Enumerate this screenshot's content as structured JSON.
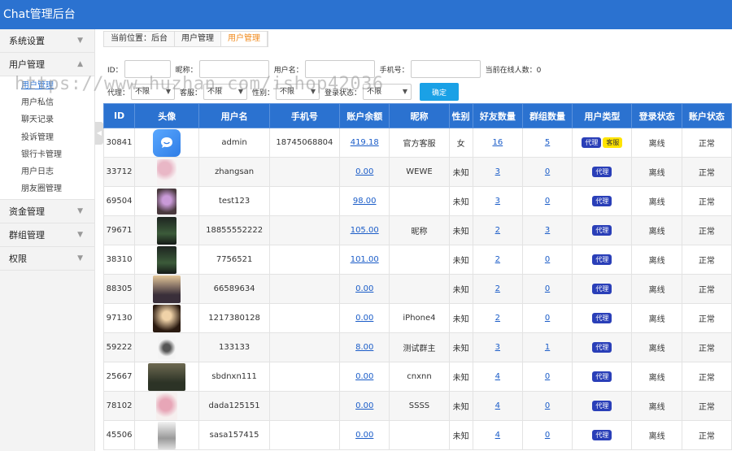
{
  "app": {
    "title": "Chat管理后台"
  },
  "sidebar": {
    "menus": [
      {
        "label": "系统设置",
        "expanded": false
      },
      {
        "label": "用户管理",
        "expanded": true,
        "items": [
          "用户管理",
          "用户私信",
          "聊天记录",
          "投诉管理",
          "银行卡管理",
          "用户日志",
          "朋友圈管理"
        ],
        "active_index": 0
      },
      {
        "label": "资金管理",
        "expanded": false
      },
      {
        "label": "群组管理",
        "expanded": false
      },
      {
        "label": "权限",
        "expanded": false
      }
    ]
  },
  "breadcrumb": [
    "当前位置：后台",
    "用户管理",
    "用户管理"
  ],
  "filters": {
    "id_label": "ID：",
    "nickname_label": "昵称：",
    "username_label": "用户名：",
    "phone_label": "手机号：",
    "online_text": "当前在线人数：0",
    "agent_label": "代理：",
    "agent_value": "不限",
    "cs_label": "客服：",
    "cs_value": "不限",
    "gender_label": "性别：",
    "gender_value": "不限",
    "login_label": "登录状态：",
    "login_value": "不限",
    "confirm": "确定"
  },
  "watermark": "https://www.huzhan.com/ishop42036",
  "table": {
    "headers": [
      "ID",
      "头像",
      "用户名",
      "手机号",
      "账户余额",
      "昵称",
      "性别",
      "好友数量",
      "群组数量",
      "用户类型",
      "登录状态",
      "账户状态"
    ],
    "rows": [
      {
        "id": "30841",
        "avatar": "chat-logo",
        "username": "admin",
        "phone": "18745068804",
        "balance": "419.18",
        "nickname": "官方客服",
        "gender": "女",
        "friends": "16",
        "groups": "5",
        "types": [
          "代理",
          "客服"
        ],
        "login": "离线",
        "status": "正常"
      },
      {
        "id": "33712",
        "avatar": "flowers",
        "username": "zhangsan",
        "phone": "",
        "balance": "0.00",
        "nickname": "WEWE",
        "gender": "未知",
        "friends": "3",
        "groups": "0",
        "types": [
          "代理"
        ],
        "login": "离线",
        "status": "正常"
      },
      {
        "id": "69504",
        "avatar": "purple-flower",
        "username": "test123",
        "phone": "",
        "balance": "98.00",
        "nickname": "",
        "gender": "未知",
        "friends": "3",
        "groups": "0",
        "types": [
          "代理"
        ],
        "login": "离线",
        "status": "正常"
      },
      {
        "id": "79671",
        "avatar": "dark-plant",
        "username": "18855552222",
        "phone": "",
        "balance": "105.00",
        "nickname": "昵称",
        "gender": "未知",
        "friends": "2",
        "groups": "3",
        "types": [
          "代理"
        ],
        "login": "离线",
        "status": "正常"
      },
      {
        "id": "38310",
        "avatar": "dark-plant",
        "username": "7756521",
        "phone": "",
        "balance": "101.00",
        "nickname": "",
        "gender": "未知",
        "friends": "2",
        "groups": "0",
        "types": [
          "代理"
        ],
        "login": "离线",
        "status": "正常"
      },
      {
        "id": "88305",
        "avatar": "anime-boy",
        "username": "66589634",
        "phone": "",
        "balance": "0.00",
        "nickname": "",
        "gender": "未知",
        "friends": "2",
        "groups": "0",
        "types": [
          "代理"
        ],
        "login": "离线",
        "status": "正常"
      },
      {
        "id": "97130",
        "avatar": "glow-portrait",
        "username": "1217380128",
        "phone": "",
        "balance": "0.00",
        "nickname": "iPhone4",
        "gender": "未知",
        "friends": "2",
        "groups": "0",
        "types": [
          "代理"
        ],
        "login": "离线",
        "status": "正常"
      },
      {
        "id": "59222",
        "avatar": "small-figure",
        "username": "133133",
        "phone": "",
        "balance": "8.00",
        "nickname": "测试群主",
        "gender": "未知",
        "friends": "3",
        "groups": "1",
        "types": [
          "代理"
        ],
        "login": "离线",
        "status": "正常"
      },
      {
        "id": "25667",
        "avatar": "birds",
        "username": "sbdnxn111",
        "phone": "",
        "balance": "0.00",
        "nickname": "cnxnn",
        "gender": "未知",
        "friends": "4",
        "groups": "0",
        "types": [
          "代理"
        ],
        "login": "离线",
        "status": "正常"
      },
      {
        "id": "78102",
        "avatar": "pink-blossom",
        "username": "dada125151",
        "phone": "",
        "balance": "0.00",
        "nickname": "SSSS",
        "gender": "未知",
        "friends": "4",
        "groups": "0",
        "types": [
          "代理"
        ],
        "login": "离线",
        "status": "正常"
      },
      {
        "id": "45506",
        "avatar": "bw-figure",
        "username": "sasa157415",
        "phone": "",
        "balance": "0.00",
        "nickname": "",
        "gender": "未知",
        "friends": "4",
        "groups": "0",
        "types": [
          "代理"
        ],
        "login": "离线",
        "status": "正常"
      }
    ]
  }
}
